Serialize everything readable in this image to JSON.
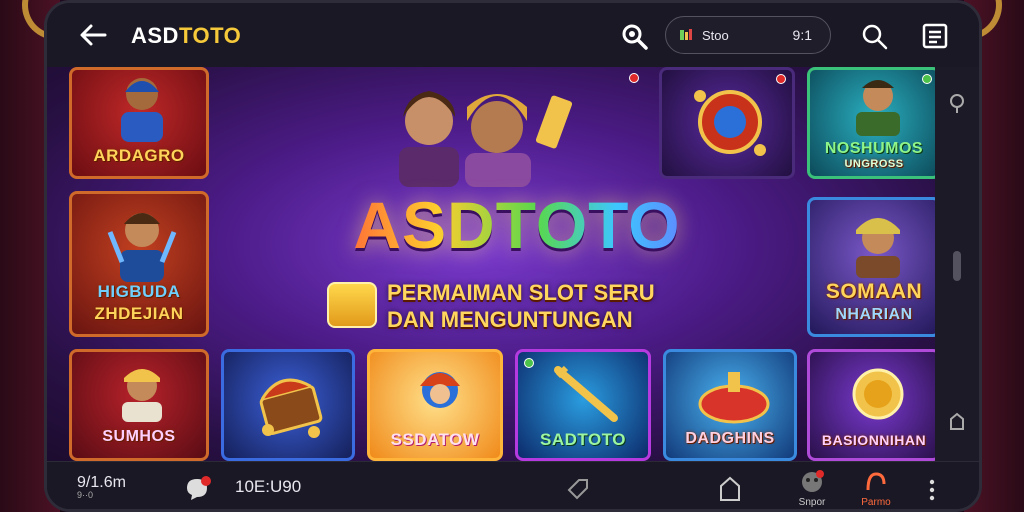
{
  "header": {
    "title_main": "ASD",
    "title_accent": "TOTO",
    "balance_label": "Stoo",
    "balance_value": "9:1"
  },
  "hero": {
    "title": "ASDTOTO",
    "subtitle_line1": "PERMAIMAN SLOT SERU",
    "subtitle_line2": "DAN MENGUNTUNGAN"
  },
  "tiles": {
    "t1": "ARDAGRO",
    "t2_line1": "HIGBUDA",
    "t2_line2": "ZHDEJIAN",
    "t3_line1": "NOSHUMOS",
    "t3_line2": "UNGROSS",
    "t4_line1": "SOMAAN",
    "t4_line2": "NHARIAN",
    "t5": "SUMHOS",
    "t6": "",
    "t7": "SSDATOW",
    "t8": "SADTOTO",
    "t9": "DADGHINS",
    "t10": "BASIONNIHAN"
  },
  "footer": {
    "left_value": "9/1.6m",
    "left_sub": "9··0",
    "time": "10E:U90",
    "item_support": "Snpor",
    "item_promo": "Parmo"
  },
  "colors": {
    "accent": "#f6c93b",
    "topbar": "#1a1824",
    "promo": "#ff6a3d"
  },
  "icons": [
    "back-arrow-icon",
    "search-coin-icon",
    "search-icon",
    "menu-icon",
    "user-icon",
    "lock-icon",
    "home-icon",
    "chat-icon",
    "gift-icon",
    "more-icon"
  ]
}
